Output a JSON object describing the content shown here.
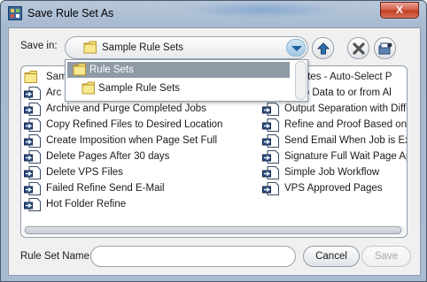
{
  "window": {
    "title": "Save Rule Set As",
    "close_label": "X"
  },
  "toolbar": {
    "save_in_label": "Save in:",
    "save_in_value": "Sample Rule Sets",
    "icons": [
      "up-folder-icon",
      "delete-icon",
      "new-folder-icon"
    ]
  },
  "dropdown": {
    "options": [
      {
        "label": "Rule Sets",
        "selected": true
      },
      {
        "label": "Sample Rule Sets",
        "selected": false
      }
    ]
  },
  "file_list": {
    "column1": [
      {
        "label": "Sam",
        "type": "folder"
      },
      {
        "label": "Arc",
        "type": "ruleset"
      },
      {
        "label": "Archive and Purge Completed Jobs",
        "type": "ruleset"
      },
      {
        "label": "Copy Refined Files to Desired Location",
        "type": "ruleset"
      },
      {
        "label": "Create Imposition when Page Set Full",
        "type": "ruleset"
      },
      {
        "label": "Delete Pages After 30 days",
        "type": "ruleset"
      },
      {
        "label": "Delete VPS Files",
        "type": "ruleset"
      },
      {
        "label": "Failed Refine Send E-Mail",
        "type": "ruleset"
      },
      {
        "label": "Hot Folder Refine",
        "type": "ruleset"
      }
    ],
    "column2": [
      {
        "label": "e Plates - Auto-Select P",
        "type": "ruleset"
      },
      {
        "label": "e Job Data to or from Al",
        "type": "ruleset"
      },
      {
        "label": "Output Separation with Diffe",
        "type": "ruleset"
      },
      {
        "label": "Refine and Proof Based on",
        "type": "ruleset"
      },
      {
        "label": "Send Email When Job is Exp",
        "type": "ruleset"
      },
      {
        "label": "Signature Full Wait Page Ap",
        "type": "ruleset"
      },
      {
        "label": "Simple Job Workflow",
        "type": "ruleset"
      },
      {
        "label": "VPS Approved Pages",
        "type": "ruleset"
      }
    ]
  },
  "bottom": {
    "name_label": "Rule Set Name:",
    "name_value": "",
    "cancel_label": "Cancel",
    "save_label": "Save"
  },
  "colors": {
    "selection": "#8f9aa6",
    "close_red": "#c23d22",
    "combo_arrow": "#1f5e98"
  }
}
